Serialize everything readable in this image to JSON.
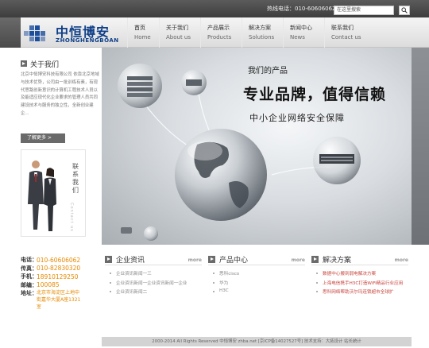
{
  "topbar": {
    "hotline": "热线电话：010-60606062",
    "search_placeholder": "在这里搜索"
  },
  "logo": {
    "cn": "中恒博安",
    "en": "ZHONGHENGBOAN"
  },
  "nav": [
    {
      "cn": "首页",
      "en": "Home"
    },
    {
      "cn": "关于我们",
      "en": "About us"
    },
    {
      "cn": "产品展示",
      "en": "Products"
    },
    {
      "cn": "解决方案",
      "en": "Solutions"
    },
    {
      "cn": "新闻中心",
      "en": "News"
    },
    {
      "cn": "联系我们",
      "en": "Contact us"
    }
  ],
  "about": {
    "title": "关于我们",
    "text": "北京中恒博安科技有限公司 依靠北京地域与技术优势，公司由一批训练有素，有现代思路创新意识的计算机工程技术人员以及能适应现代化企业要求的管理人员共同建设技术与服务的独立性，全新创业建企...",
    "more": "了解更多 >"
  },
  "contact_card": {
    "vertical_cn": "联系我们",
    "vertical_en": "Contact us"
  },
  "contact": {
    "phone_label": "电话：",
    "phone": "010-60606062",
    "fax_label": "传真：",
    "fax": "010-82830320",
    "mobile_label": "手机：",
    "mobile": "18910129250",
    "postcode_label": "邮编：",
    "postcode": "100085",
    "address_label": "地址：",
    "address": "北京市海淀区上地中街嘉华大厦A座1321室"
  },
  "banner": {
    "heading": "我们的产品",
    "slogan": "专业品牌，值得信赖",
    "subtitle": "中小企业网络安全保障"
  },
  "columns": [
    {
      "title": "企业资讯",
      "more": "more",
      "items": [
        "企业资讯新闻一三",
        "企业资讯新闻一企业资讯新闻一企业",
        "企业资讯新闻二"
      ]
    },
    {
      "title": "产品中心",
      "more": "more",
      "items": [
        "思科cisco",
        "华为",
        "H3C"
      ]
    },
    {
      "title": "解决方案",
      "more": "more",
      "items": [
        "数据中心搬到弱电解决方案",
        "上海电信携手H3C打造WiFi精品行业应用",
        "思科网络帮助沃尔玛连锁超市全球扩"
      ]
    }
  ],
  "footer": {
    "text": "2000-2014 All Rights Reserved 中恒博安 zhba.net [京ICP备14027527号] 技术支持：大拓设计  站长统计"
  }
}
